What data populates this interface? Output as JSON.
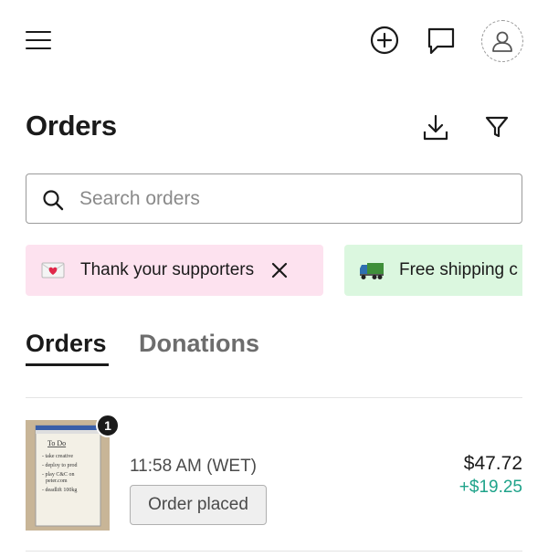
{
  "topbar": {
    "icons": [
      "menu-icon",
      "add-circle-icon",
      "message-icon",
      "account-icon"
    ]
  },
  "header": {
    "title": "Orders",
    "icons": [
      "download-icon",
      "filter-icon"
    ]
  },
  "search": {
    "placeholder": "Search orders",
    "value": ""
  },
  "chips": [
    {
      "emoji": "envelope-heart-icon",
      "label": "Thank your supporters",
      "dismiss": "close-icon",
      "bg": "#fde2ef"
    },
    {
      "emoji": "delivery-truck-icon",
      "label": "Free shipping c",
      "bg": "#dbf7df"
    }
  ],
  "tabs": [
    {
      "label": "Orders",
      "active": true
    },
    {
      "label": "Donations",
      "active": false
    }
  ],
  "orders": [
    {
      "quantity": "1",
      "time": "11:58 AM (WET)",
      "status": "Order placed",
      "total": "$47.72",
      "delta": "+$19.25",
      "thumbnail_lines": [
        "To Do",
        "- take creative",
        "- deploy to prod",
        "- play C&C on",
        "  peter.com",
        "- deadlift 100kg"
      ]
    }
  ],
  "colors": {
    "text": "#1a1a1a",
    "muted": "#6d6d6d",
    "positive": "#1fa38a",
    "chip_pink": "#fde2ef",
    "chip_green": "#dbf7df"
  }
}
